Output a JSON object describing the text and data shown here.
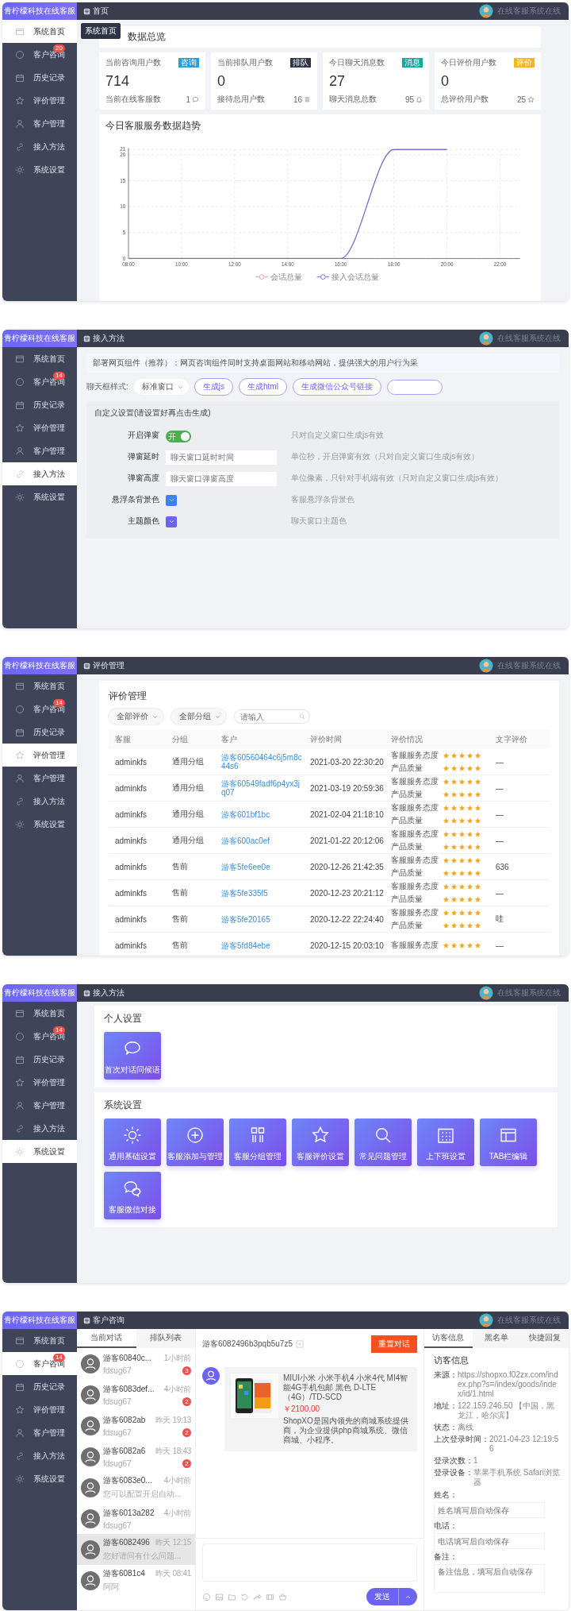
{
  "screens": [
    {
      "kind": "dashboard",
      "brand": "青柠檬科技在线客服",
      "breadcrumb": "首页",
      "status": "在线客服系统在线",
      "tooltip": "系统首页",
      "nav": [
        {
          "label": "系统首页",
          "selected": true
        },
        {
          "label": "客户咨询",
          "badge": "20",
          "selected": false
        },
        {
          "label": "历史记录",
          "selected": false
        },
        {
          "label": "评价管理",
          "selected": false
        },
        {
          "label": "客户管理",
          "selected": false
        },
        {
          "label": "接入方法",
          "selected": false
        },
        {
          "label": "系统设置",
          "selected": false
        }
      ],
      "overview_title": "数据总览",
      "stats": [
        {
          "title": "当前咨询用户数",
          "tag": "咨询",
          "color": "#2d9cdb",
          "value": "714",
          "sub_label": "当前在线客服数",
          "sub_value": "1"
        },
        {
          "title": "当前排队用户数",
          "tag": "排队",
          "color": "#2f3447",
          "value": "0",
          "sub_label": "接待总用户数",
          "sub_value": "16"
        },
        {
          "title": "今日聊天消息数",
          "tag": "消息",
          "color": "#13a89e",
          "value": "27",
          "sub_label": "聊天消息总数",
          "sub_value": "95"
        },
        {
          "title": "今日评价用户数",
          "tag": "评价",
          "color": "#f5b716",
          "value": "0",
          "sub_label": "总评价用户数",
          "sub_value": "25"
        }
      ],
      "chart": {
        "title": "今日客服服务数据趋势",
        "chart_data": {
          "type": "line",
          "categories": [
            "08:00",
            "10:00",
            "12:00",
            "14:00",
            "16:00",
            "18:00",
            "20:00",
            "22:00"
          ],
          "series": [
            {
              "name": "会话总量",
              "color": "#e8a0b4",
              "values": [
                null,
                null,
                null,
                null,
                null,
                null,
                null,
                null
              ]
            },
            {
              "name": "接入会话总量",
              "color": "#7b6fc8",
              "values": [
                0,
                0,
                0,
                0,
                0,
                21,
                21,
                null
              ]
            }
          ],
          "ylim": [
            0,
            21
          ],
          "yticks": [
            {
              "value": 0,
              "label": "0"
            },
            {
              "value": 5,
              "label": "5"
            },
            {
              "value": 10,
              "label": "10"
            },
            {
              "value": 15,
              "label": "15"
            },
            {
              "value": 20,
              "label": "20"
            },
            {
              "value": 21,
              "label": "21"
            }
          ],
          "grid": true,
          "legend": true
        }
      }
    },
    {
      "kind": "embed",
      "brand": "青柠檬科技在线客服",
      "breadcrumb": "接入方法",
      "status": "在线客服系统在线",
      "nav": [
        {
          "label": "系统首页",
          "selected": false
        },
        {
          "label": "客户咨询",
          "badge": "14",
          "selected": false
        },
        {
          "label": "历史记录",
          "selected": false
        },
        {
          "label": "评价管理",
          "selected": false
        },
        {
          "label": "客户管理",
          "selected": false
        },
        {
          "label": "接入方法",
          "selected": true
        },
        {
          "label": "系统设置",
          "selected": false
        }
      ],
      "notice": "部署网页组件（推荐）：网页咨询组件同时支持桌面网站和移动网站，提供强大的用户行为采",
      "style_label": "聊天框样式:",
      "style_select": "标准窗口",
      "buttons": [
        "生成js",
        "生成html",
        "生成微信公众号链接"
      ],
      "custom_title": "自定义设置(请设置好再点击生成)",
      "rows": [
        {
          "kind": "toggle",
          "label": "开启弹窗",
          "on": true,
          "toggle_text": "开",
          "hint": "只对自定义窗口生成js有效"
        },
        {
          "kind": "input",
          "label": "弹窗延时",
          "placeholder": "聊天窗口延时时间",
          "hint": "单位秒，开启弹窗有效（只对自定义窗口生成js有效）"
        },
        {
          "kind": "input",
          "label": "弹窗高度",
          "placeholder": "聊天窗口弹窗高度",
          "hint": "单位像素，只针对手机端有效（只对自定义窗口生成js有效）"
        },
        {
          "kind": "color",
          "label": "悬浮条背景色",
          "color": "#3b82f6",
          "hint": "客服悬浮条背景色"
        },
        {
          "kind": "color",
          "label": "主题颜色",
          "color": "#6c63f0",
          "hint": "聊天窗口主题色"
        }
      ]
    },
    {
      "kind": "reviews",
      "brand": "青柠檬科技在线客服",
      "breadcrumb": "评价管理",
      "status": "在线客服系统在线",
      "nav": [
        {
          "label": "系统首页",
          "selected": false
        },
        {
          "label": "客户咨询",
          "badge": "14",
          "selected": false
        },
        {
          "label": "历史记录",
          "selected": false
        },
        {
          "label": "评价管理",
          "selected": true
        },
        {
          "label": "客户管理",
          "selected": false
        },
        {
          "label": "接入方法",
          "selected": false
        },
        {
          "label": "系统设置",
          "selected": false
        }
      ],
      "title": "评价管理",
      "filters": [
        "全部评价",
        "全部分组"
      ],
      "search_placeholder": "请输入",
      "columns": [
        "客服",
        "分组",
        "客户",
        "评价时间",
        "评价情况",
        "文字评价"
      ],
      "rows": [
        {
          "agent": "adminkfs",
          "group": "通用分组",
          "customer": "游客60560464c6j5m8c44s6",
          "time": "2021-03-20 22:30:20",
          "ratings": [
            {
              "label": "客服服务态度",
              "stars": 5
            },
            {
              "label": "产品质量",
              "stars": 5
            }
          ],
          "comment": "—"
        },
        {
          "agent": "adminkfs",
          "group": "通用分组",
          "customer": "游客60549fadf6p4yx3jq07",
          "time": "2021-03-19 20:59:36",
          "ratings": [
            {
              "label": "客服服务态度",
              "stars": 5
            },
            {
              "label": "产品质量",
              "stars": 5
            }
          ],
          "comment": "—"
        },
        {
          "agent": "adminkfs",
          "group": "通用分组",
          "customer": "游客601bf1bc",
          "time": "2021-02-04 21:18:10",
          "ratings": [
            {
              "label": "客服服务态度",
              "stars": 5
            },
            {
              "label": "产品质量",
              "stars": 5
            }
          ],
          "comment": "—"
        },
        {
          "agent": "adminkfs",
          "group": "通用分组",
          "customer": "游客600ac0ef",
          "time": "2021-01-22 20:12:06",
          "ratings": [
            {
              "label": "客服服务态度",
              "stars": 5
            },
            {
              "label": "产品质量",
              "stars": 5
            }
          ],
          "comment": "—"
        },
        {
          "agent": "adminkfs",
          "group": "售前",
          "customer": "游客5fe6ee0e",
          "time": "2020-12-26 21:42:35",
          "ratings": [
            {
              "label": "客服服务态度",
              "stars": 5
            },
            {
              "label": "产品质量",
              "stars": 5
            }
          ],
          "comment": "636"
        },
        {
          "agent": "adminkfs",
          "group": "售前",
          "customer": "游客5fe335f5",
          "time": "2020-12-23 20:21:12",
          "ratings": [
            {
              "label": "客服服务态度",
              "stars": 5
            },
            {
              "label": "产品质量",
              "stars": 5
            }
          ],
          "comment": "—"
        },
        {
          "agent": "adminkfs",
          "group": "售前",
          "customer": "游客5fe20165",
          "time": "2020-12-22 22:24:40",
          "ratings": [
            {
              "label": "客服服务态度",
              "stars": 5
            },
            {
              "label": "产品质量",
              "stars": 5
            }
          ],
          "comment": "哇"
        },
        {
          "agent": "adminkfs",
          "group": "售前",
          "customer": "游客5fd84ebe",
          "time": "2020-12-15 20:03:10",
          "ratings": [
            {
              "label": "客服服务态度",
              "stars": 5
            }
          ],
          "comment": "—"
        }
      ]
    },
    {
      "kind": "settings",
      "brand": "青柠檬科技在线客服",
      "breadcrumb": "接入方法",
      "status": "在线客服系统在线",
      "nav": [
        {
          "label": "系统首页",
          "selected": false
        },
        {
          "label": "客户咨询",
          "badge": "14",
          "selected": false
        },
        {
          "label": "历史记录",
          "selected": false
        },
        {
          "label": "评价管理",
          "selected": false
        },
        {
          "label": "客户管理",
          "selected": false
        },
        {
          "label": "接入方法",
          "selected": false
        },
        {
          "label": "系统设置",
          "selected": true
        }
      ],
      "sections": [
        {
          "title": "个人设置",
          "tiles": [
            "首次对话问候语"
          ]
        },
        {
          "title": "系统设置",
          "tiles": [
            "通用基础设置",
            "客服添加与管理",
            "客服分组管理",
            "客服评价设置",
            "常见问题管理",
            "上下班设置",
            "TAB栏编辑",
            "客服微信对接"
          ]
        }
      ]
    },
    {
      "kind": "chat",
      "brand": "青柠檬科技在线客服",
      "breadcrumb": "客户咨询",
      "status": "在线客服系统在线",
      "nav": [
        {
          "label": "系统首页",
          "selected": false
        },
        {
          "label": "客户咨询",
          "badge": "14",
          "selected": true
        },
        {
          "label": "历史记录",
          "selected": false
        },
        {
          "label": "评价管理",
          "selected": false
        },
        {
          "label": "客户管理",
          "selected": false
        },
        {
          "label": "接入方法",
          "selected": false
        },
        {
          "label": "系统设置",
          "selected": false
        }
      ],
      "list_tabs": [
        {
          "label": "当前对话",
          "selected": true
        },
        {
          "label": "排队列表",
          "selected": false
        }
      ],
      "conversations": [
        {
          "name": "游客60840c...",
          "time": "1小时前",
          "preview": "fdsug67",
          "unread": "3",
          "selected": false
        },
        {
          "name": "游客6083def...",
          "time": "4小时前",
          "preview": "fdsug67",
          "unread": "2",
          "selected": false
        },
        {
          "name": "游客6082ab",
          "time": "昨天 19:13",
          "preview": "fdsug67",
          "unread": "2",
          "selected": false
        },
        {
          "name": "游客6082a6",
          "time": "昨天 18:43",
          "preview": "fdsug67",
          "unread": "2",
          "selected": false
        },
        {
          "name": "游客6083e0...",
          "time": "4小时前",
          "preview": "您可以配置开启自动...",
          "selected": false
        },
        {
          "name": "游客6013a282",
          "time": "4小时前",
          "preview": "fdsug67",
          "selected": false
        },
        {
          "name": "游客6082496",
          "time": "昨天 12:15",
          "preview": "您好请问有什么问题...",
          "selected": true
        },
        {
          "name": "游客6081c4",
          "time": "昨天 08:41",
          "preview": "阿阿",
          "selected": false
        }
      ],
      "chat_title": "游客6082496b3pqb5u7z5",
      "end_button": "重置对话",
      "message": {
        "title": "MIUI小米 小米手机4 小米4代 MI4智能4G手机包邮 黑色 D-LTE（4G）/TD-SCD",
        "price": "￥2100.00",
        "desc": "ShopXO是国内领先的商城系统提供商，为企业提供php商城系统、微信商城、小程序。"
      },
      "send_button": "发送",
      "info_tabs": [
        {
          "label": "访客信息",
          "selected": true
        },
        {
          "label": "黑名单",
          "selected": false
        },
        {
          "label": "快捷回复",
          "selected": false
        }
      ],
      "info_title": "访客信息",
      "info": [
        {
          "label": "来源：",
          "value": "https://shopxo.f02zx.com/index.php?s=/index/goods/index/id/1.html"
        },
        {
          "label": "地址：",
          "value": "122.159.246.50 【中国，黑龙江，哈尔滨】"
        },
        {
          "label": "状态：",
          "value": "离线"
        },
        {
          "label": "上次登录时间：",
          "value": "2021-04-23 12:19:56"
        },
        {
          "label": "登录次数：",
          "value": "1"
        },
        {
          "label": "登录设备：",
          "value": "苹果手机系统 Safari浏览器"
        }
      ],
      "form": [
        {
          "kind": "input",
          "label": "姓名：",
          "placeholder": "姓名填写后自动保存"
        },
        {
          "kind": "input",
          "label": "电话：",
          "placeholder": "电话填写后自动保存"
        },
        {
          "kind": "textarea",
          "label": "备注：",
          "placeholder": "备注信息，填写后自动保存"
        }
      ]
    }
  ]
}
